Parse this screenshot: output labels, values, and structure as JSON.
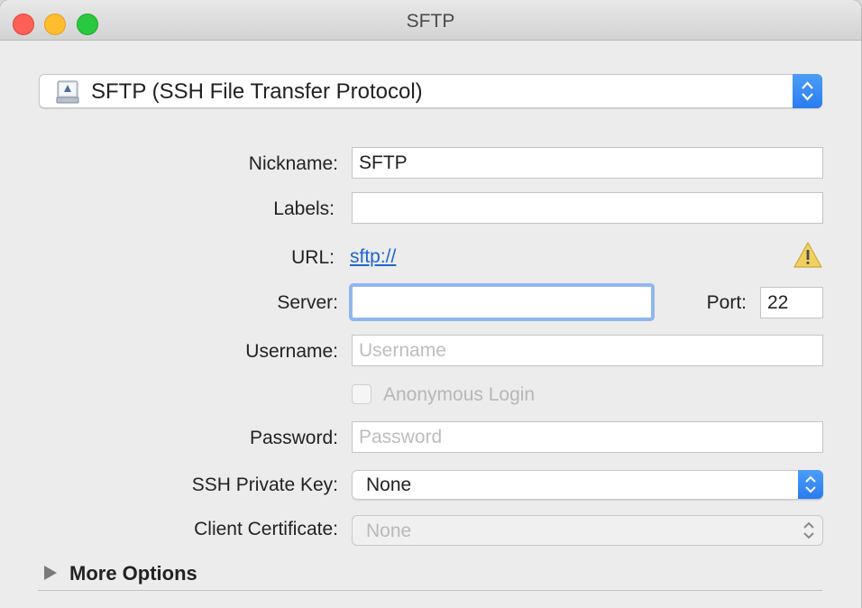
{
  "window": {
    "title": "SFTP"
  },
  "protocol": {
    "label": "SFTP (SSH File Transfer Protocol)",
    "icon": "network-drive-icon"
  },
  "form": {
    "nickname": {
      "label": "Nickname:",
      "value": "SFTP"
    },
    "labels": {
      "label": "Labels:",
      "value": ""
    },
    "url": {
      "label": "URL:",
      "link": "sftp://",
      "warning_icon": "warning-icon"
    },
    "server": {
      "label": "Server:",
      "value": ""
    },
    "port": {
      "label": "Port:",
      "value": "22"
    },
    "username": {
      "label": "Username:",
      "placeholder": "Username"
    },
    "anonymous": {
      "label": "Anonymous Login",
      "checked": false
    },
    "password": {
      "label": "Password:",
      "placeholder": "Password"
    },
    "ssh_key": {
      "label": "SSH Private Key:",
      "value": "None"
    },
    "client_cert": {
      "label": "Client Certificate:",
      "value": "None"
    }
  },
  "more_options": {
    "label": "More Options",
    "icon": "disclosure-triangle-icon"
  },
  "colors": {
    "accent": "#2a7cf0",
    "link": "#1f66cf",
    "warning": "#f2d15f"
  }
}
